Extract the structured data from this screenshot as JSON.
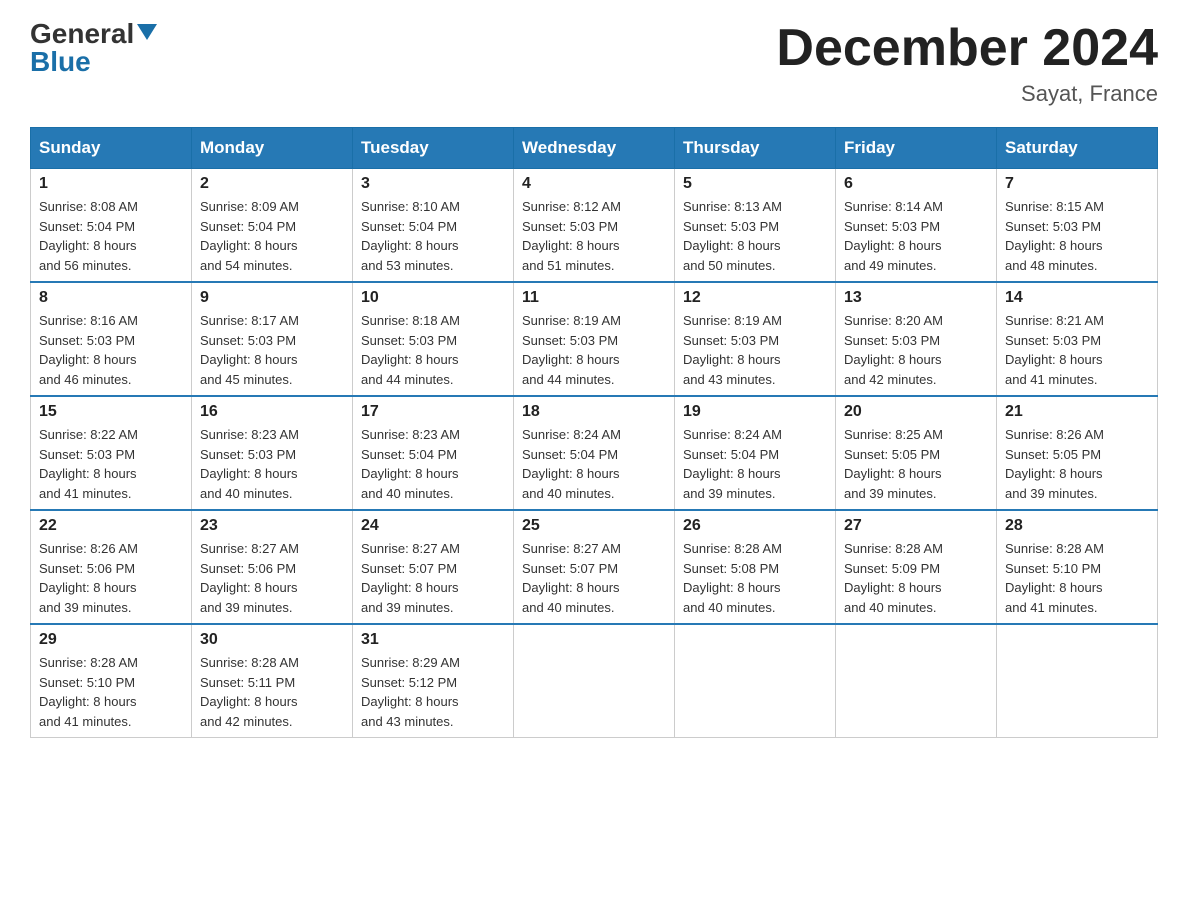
{
  "header": {
    "logo": {
      "general": "General",
      "blue": "Blue"
    },
    "title": "December 2024",
    "location": "Sayat, France"
  },
  "weekdays": [
    "Sunday",
    "Monday",
    "Tuesday",
    "Wednesday",
    "Thursday",
    "Friday",
    "Saturday"
  ],
  "weeks": [
    [
      {
        "day": "1",
        "sunrise": "8:08 AM",
        "sunset": "5:04 PM",
        "daylight": "8 hours and 56 minutes."
      },
      {
        "day": "2",
        "sunrise": "8:09 AM",
        "sunset": "5:04 PM",
        "daylight": "8 hours and 54 minutes."
      },
      {
        "day": "3",
        "sunrise": "8:10 AM",
        "sunset": "5:04 PM",
        "daylight": "8 hours and 53 minutes."
      },
      {
        "day": "4",
        "sunrise": "8:12 AM",
        "sunset": "5:03 PM",
        "daylight": "8 hours and 51 minutes."
      },
      {
        "day": "5",
        "sunrise": "8:13 AM",
        "sunset": "5:03 PM",
        "daylight": "8 hours and 50 minutes."
      },
      {
        "day": "6",
        "sunrise": "8:14 AM",
        "sunset": "5:03 PM",
        "daylight": "8 hours and 49 minutes."
      },
      {
        "day": "7",
        "sunrise": "8:15 AM",
        "sunset": "5:03 PM",
        "daylight": "8 hours and 48 minutes."
      }
    ],
    [
      {
        "day": "8",
        "sunrise": "8:16 AM",
        "sunset": "5:03 PM",
        "daylight": "8 hours and 46 minutes."
      },
      {
        "day": "9",
        "sunrise": "8:17 AM",
        "sunset": "5:03 PM",
        "daylight": "8 hours and 45 minutes."
      },
      {
        "day": "10",
        "sunrise": "8:18 AM",
        "sunset": "5:03 PM",
        "daylight": "8 hours and 44 minutes."
      },
      {
        "day": "11",
        "sunrise": "8:19 AM",
        "sunset": "5:03 PM",
        "daylight": "8 hours and 44 minutes."
      },
      {
        "day": "12",
        "sunrise": "8:19 AM",
        "sunset": "5:03 PM",
        "daylight": "8 hours and 43 minutes."
      },
      {
        "day": "13",
        "sunrise": "8:20 AM",
        "sunset": "5:03 PM",
        "daylight": "8 hours and 42 minutes."
      },
      {
        "day": "14",
        "sunrise": "8:21 AM",
        "sunset": "5:03 PM",
        "daylight": "8 hours and 41 minutes."
      }
    ],
    [
      {
        "day": "15",
        "sunrise": "8:22 AM",
        "sunset": "5:03 PM",
        "daylight": "8 hours and 41 minutes."
      },
      {
        "day": "16",
        "sunrise": "8:23 AM",
        "sunset": "5:03 PM",
        "daylight": "8 hours and 40 minutes."
      },
      {
        "day": "17",
        "sunrise": "8:23 AM",
        "sunset": "5:04 PM",
        "daylight": "8 hours and 40 minutes."
      },
      {
        "day": "18",
        "sunrise": "8:24 AM",
        "sunset": "5:04 PM",
        "daylight": "8 hours and 40 minutes."
      },
      {
        "day": "19",
        "sunrise": "8:24 AM",
        "sunset": "5:04 PM",
        "daylight": "8 hours and 39 minutes."
      },
      {
        "day": "20",
        "sunrise": "8:25 AM",
        "sunset": "5:05 PM",
        "daylight": "8 hours and 39 minutes."
      },
      {
        "day": "21",
        "sunrise": "8:26 AM",
        "sunset": "5:05 PM",
        "daylight": "8 hours and 39 minutes."
      }
    ],
    [
      {
        "day": "22",
        "sunrise": "8:26 AM",
        "sunset": "5:06 PM",
        "daylight": "8 hours and 39 minutes."
      },
      {
        "day": "23",
        "sunrise": "8:27 AM",
        "sunset": "5:06 PM",
        "daylight": "8 hours and 39 minutes."
      },
      {
        "day": "24",
        "sunrise": "8:27 AM",
        "sunset": "5:07 PM",
        "daylight": "8 hours and 39 minutes."
      },
      {
        "day": "25",
        "sunrise": "8:27 AM",
        "sunset": "5:07 PM",
        "daylight": "8 hours and 40 minutes."
      },
      {
        "day": "26",
        "sunrise": "8:28 AM",
        "sunset": "5:08 PM",
        "daylight": "8 hours and 40 minutes."
      },
      {
        "day": "27",
        "sunrise": "8:28 AM",
        "sunset": "5:09 PM",
        "daylight": "8 hours and 40 minutes."
      },
      {
        "day": "28",
        "sunrise": "8:28 AM",
        "sunset": "5:10 PM",
        "daylight": "8 hours and 41 minutes."
      }
    ],
    [
      {
        "day": "29",
        "sunrise": "8:28 AM",
        "sunset": "5:10 PM",
        "daylight": "8 hours and 41 minutes."
      },
      {
        "day": "30",
        "sunrise": "8:28 AM",
        "sunset": "5:11 PM",
        "daylight": "8 hours and 42 minutes."
      },
      {
        "day": "31",
        "sunrise": "8:29 AM",
        "sunset": "5:12 PM",
        "daylight": "8 hours and 43 minutes."
      },
      null,
      null,
      null,
      null
    ]
  ],
  "labels": {
    "sunrise": "Sunrise:",
    "sunset": "Sunset:",
    "daylight": "Daylight:"
  }
}
